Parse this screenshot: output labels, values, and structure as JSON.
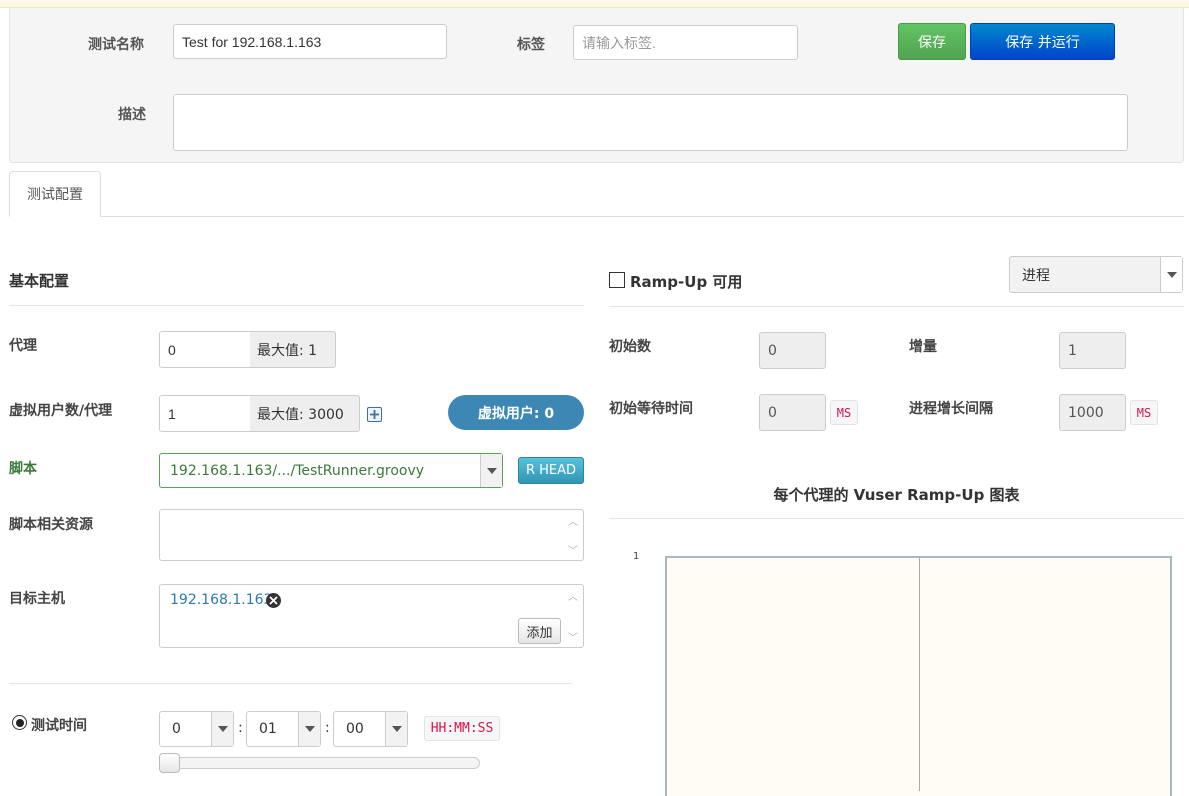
{
  "header": {
    "test_name_label": "测试名称",
    "test_name_value": "Test for 192.168.1.163",
    "tag_label": "标签",
    "tag_placeholder": "请输入标签.",
    "save_label": "保存",
    "save_run_label": "保存 并运行",
    "description_label": "描述",
    "description_value": ""
  },
  "tabs": [
    {
      "label": "测试配置"
    }
  ],
  "basic": {
    "title": "基本配置",
    "agent_label": "代理",
    "agent_value": "0",
    "agent_max": "最大值: 1",
    "vuser_label": "虚拟用户数/代理",
    "vuser_value": "1",
    "vuser_max": "最大值: 3000",
    "vuser_total": "虚拟用户: 0",
    "script_label": "脚本",
    "script_value": "192.168.1.163/.../TestRunner.groovy",
    "script_button": "R HEAD",
    "resources_label": "脚本相关资源",
    "target_label": "目标主机",
    "target_host": "192.168.1.163",
    "add_button": "添加",
    "duration_label": "测试时间",
    "hours": "0",
    "minutes": "01",
    "seconds": "00",
    "time_format": "HH:MM:SS",
    "colon": ":",
    "slider_value": 0
  },
  "rampup": {
    "enabled_label": "Ramp-Up 可用",
    "mode_value": "进程",
    "initial_count_label": "初始数",
    "initial_count_value": "0",
    "increment_label": "增量",
    "increment_value": "1",
    "initial_sleep_label": "初始等待时间",
    "initial_sleep_value": "0",
    "ms": "MS",
    "interval_label": "进程增长间隔",
    "interval_value": "1000",
    "chart_title": "每个代理的 Vuser Ramp-Up 图表",
    "chart_y_tick": "1"
  }
}
